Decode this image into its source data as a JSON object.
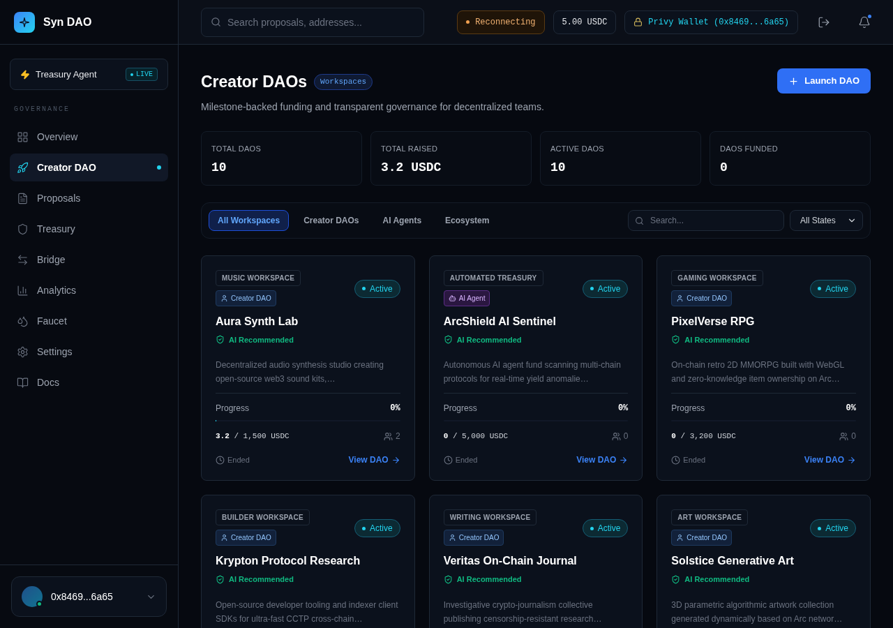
{
  "brand": {
    "name": "Syn DAO"
  },
  "agent": {
    "label": "Treasury Agent",
    "badge": "LIVE"
  },
  "sidebar": {
    "section": "GOVERNANCE",
    "items": [
      {
        "label": "Overview",
        "selected": false
      },
      {
        "label": "Creator DAO",
        "selected": true
      },
      {
        "label": "Proposals",
        "selected": false
      },
      {
        "label": "Treasury",
        "selected": false
      },
      {
        "label": "Bridge",
        "selected": false
      },
      {
        "label": "Analytics",
        "selected": false
      },
      {
        "label": "Faucet",
        "selected": false
      },
      {
        "label": "Settings",
        "selected": false
      },
      {
        "label": "Docs",
        "selected": false
      }
    ],
    "account": {
      "address": "0x8469...6a65"
    }
  },
  "topbar": {
    "search": {
      "placeholder": "Search proposals, addresses..."
    },
    "status": "Reconnecting",
    "balance": "5.00 USDC",
    "wallet": "Privy Wallet (0x8469...6a65)",
    "notifications": true
  },
  "header": {
    "title": "Creator DAOs",
    "badge": "Workspaces",
    "subtitle": "Milestone-backed funding and transparent governance for decentralized teams.",
    "action": "Launch DAO"
  },
  "stats": [
    {
      "label": "TOTAL DAOS",
      "value": "10"
    },
    {
      "label": "TOTAL RAISED",
      "value": "3.2 USDC"
    },
    {
      "label": "ACTIVE DAOS",
      "value": "10"
    },
    {
      "label": "DAOS FUNDED",
      "value": "0"
    }
  ],
  "filters": {
    "tabs": [
      {
        "label": "All Workspaces",
        "selected": true
      },
      {
        "label": "Creator DAOs",
        "selected": false
      },
      {
        "label": "AI Agents",
        "selected": false
      },
      {
        "label": "Ecosystem",
        "selected": false
      }
    ],
    "search": {
      "placeholder": "Search..."
    },
    "state": "All States"
  },
  "cards": [
    {
      "category": "MUSIC WORKSPACE",
      "kind": "creator",
      "type": "Creator DAO",
      "status": "Active",
      "title": "Aura Synth Lab",
      "recommended": "AI Recommended",
      "description": "Decentralized audio synthesis studio creating open-source web3 sound kits,…",
      "progress_label": "Progress",
      "percent": "0%",
      "level": 0.005,
      "raised": "3.2",
      "goal": "/ 1,500 USDC",
      "members": "2",
      "time": "Ended",
      "link": "View DAO"
    },
    {
      "category": "AUTOMATED TREASURY",
      "kind": "agent",
      "type": "AI Agent",
      "status": "Active",
      "title": "ArcShield AI Sentinel",
      "recommended": "AI Recommended",
      "description": "Autonomous AI agent fund scanning multi-chain protocols for real-time yield anomalie…",
      "progress_label": "Progress",
      "percent": "0%",
      "raised": "0",
      "goal": "/ 5,000 USDC",
      "members": "0",
      "time": "Ended",
      "link": "View DAO"
    },
    {
      "category": "GAMING WORKSPACE",
      "kind": "creator",
      "type": "Creator DAO",
      "status": "Active",
      "title": "PixelVerse RPG",
      "recommended": "AI Recommended",
      "description": "On-chain retro 2D MMORPG built with WebGL and zero-knowledge item ownership on Arc…",
      "progress_label": "Progress",
      "percent": "0%",
      "raised": "0",
      "goal": "/ 3,200 USDC",
      "members": "0",
      "time": "Ended",
      "link": "View DAO"
    },
    {
      "category": "BUILDER WORKSPACE",
      "kind": "creator",
      "type": "Creator DAO",
      "status": "Active",
      "title": "Krypton Protocol Research",
      "recommended": "AI Recommended",
      "description": "Open-source developer tooling and indexer client SDKs for ultra-fast CCTP cross-chain…"
    },
    {
      "category": "WRITING WORKSPACE",
      "kind": "creator",
      "type": "Creator DAO",
      "status": "Active",
      "title": "Veritas On-Chain Journal",
      "recommended": "AI Recommended",
      "description": "Investigative crypto-journalism collective publishing censorship-resistant research…"
    },
    {
      "category": "ART WORKSPACE",
      "kind": "creator",
      "type": "Creator DAO",
      "status": "Active",
      "title": "Solstice Generative Art",
      "recommended": "AI Recommended",
      "description": "3D parametric algorithmic artwork collection generated dynamically based on Arc networ…"
    }
  ]
}
